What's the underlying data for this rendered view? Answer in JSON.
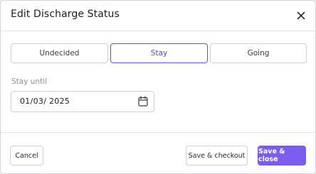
{
  "dialog": {
    "title": "Edit Discharge Status"
  },
  "status_options": [
    {
      "label": "Undecided",
      "selected": false
    },
    {
      "label": "Stay",
      "selected": true
    },
    {
      "label": "Going",
      "selected": false
    }
  ],
  "stay_until": {
    "label": "Stay until",
    "value": "01/03/ 2025"
  },
  "footer": {
    "cancel_label": "Cancel",
    "save_checkout_label": "Save & checkout",
    "save_close_label": "Save & close"
  },
  "icons": {
    "close": "close-icon",
    "calendar": "calendar-icon"
  },
  "colors": {
    "accent": "#7b5cf0",
    "selected_border": "#6c4ce0"
  }
}
